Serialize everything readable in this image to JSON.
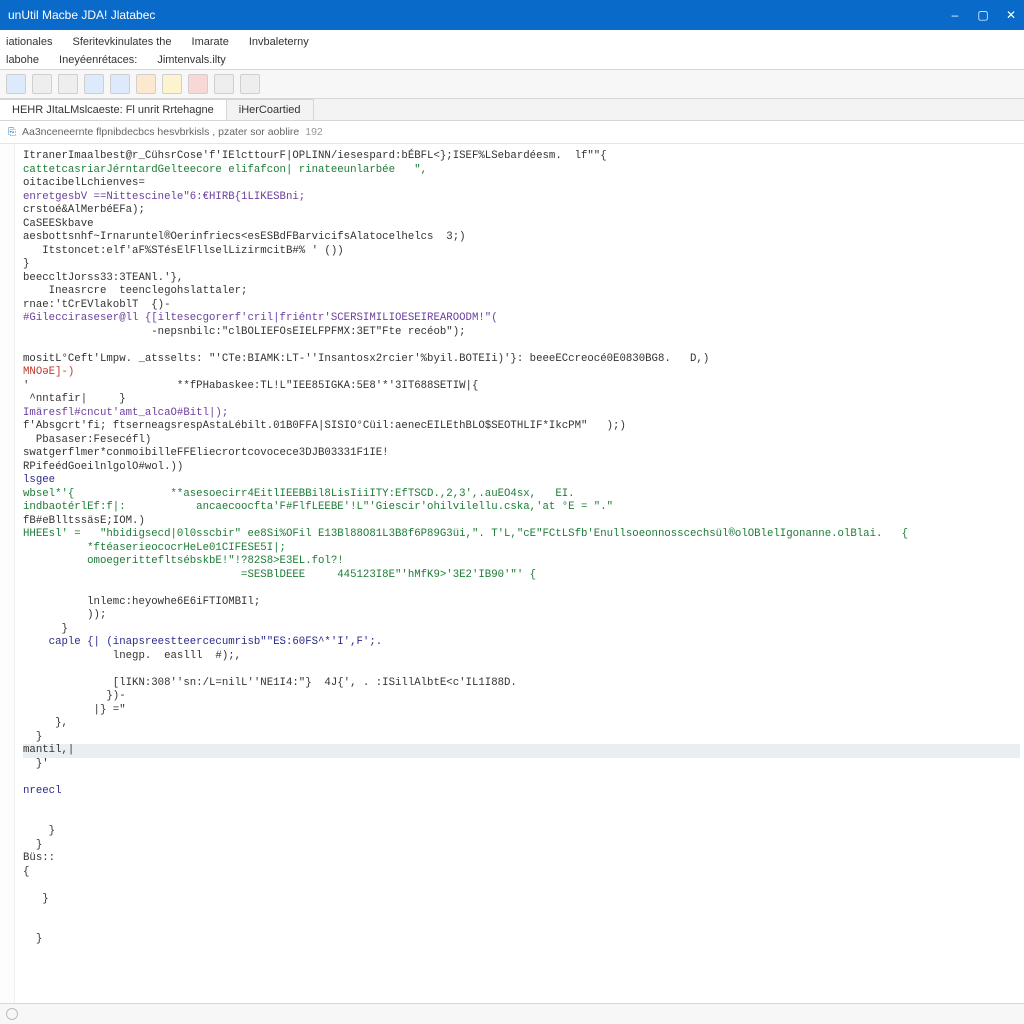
{
  "window": {
    "title": "unUtil Macbe JDA! Jlatabec"
  },
  "menu": {
    "row1": [
      "iationales",
      "Sferitevkinulates the",
      "Imarate",
      "Invbaleterny"
    ],
    "row2": [
      "labohe",
      "Ineyéenrétaces:",
      "Jimtenvals.ilty"
    ]
  },
  "toolbar_icons": [
    "page-icon",
    "layers-icon",
    "box-icon",
    "grid-icon",
    "save-icon",
    "folder-icon",
    "bullet-icon",
    "stop-icon",
    "doc-icon",
    "undo-icon"
  ],
  "toolbar_colors": [
    "blue",
    "gray",
    "gray",
    "blue",
    "blue",
    "orange",
    "yellow",
    "red",
    "gray",
    "gray"
  ],
  "tabs": [
    {
      "label": "HEHR JItaLMslcaeste: Fl  unrit  Rrtehagne",
      "active": true
    },
    {
      "label": "iHerCoartied",
      "active": false
    }
  ],
  "subheader": {
    "leading": "⎘",
    "text": "Aa3nceneernte flpnibdecbcs hesvbrkisls , pzater sor aoblire",
    "num": "192"
  },
  "code_lines": [
    {
      "t": "ItranerImaalbest@r_CühsrCose'f'IElcttourF|OPLINN/iesespard:bÉBFL<};ISEF%LSebardéesm.  lf\"\"{",
      "cls": ""
    },
    {
      "t": "cattetcasriarJérntardGelteecore elifafcon| rinateeunlarbée   \",",
      "cls": "str"
    },
    {
      "t": "oitacibelLchienves=",
      "cls": ""
    },
    {
      "t": "enretgesbV ==Nittescinele\"6:€HIRB{1LIKESBni;",
      "cls": "id"
    },
    {
      "t": "crstoé&AlMerbéEFa);",
      "cls": ""
    },
    {
      "t": "CaSEESkbave",
      "cls": ""
    },
    {
      "t": "aesbottsnhf~Irnaruntel®Oerinfriecs<esESBdFBarvicifsAlatocelhelcs  3;)",
      "cls": ""
    },
    {
      "t": "   Itstoncet:elf'aF%STésElFllselLizirmcitB#% ' ())",
      "cls": ""
    },
    {
      "t": "}",
      "cls": ""
    },
    {
      "t": "beeccltJorss33:3TEANl.'},",
      "cls": ""
    },
    {
      "t": "    Ineasrcre  teenclegohslattaler;",
      "cls": ""
    },
    {
      "t": "rnae:'tCrEVlakoblT  {)-",
      "cls": ""
    },
    {
      "t": "#Gilecciraseser@ll {[iltesecgorerf'cril|friéntr'SCERSIMILIOESEIREAROODM!\"(",
      "cls": "id"
    },
    {
      "t": "                    -nepsnbilc:\"clBOLIEFOsEIELFPFMX:3ET\"Fte recéob\");",
      "cls": ""
    },
    {
      "t": "",
      "cls": ""
    },
    {
      "t": "mositL°Ceft'Lmpw. _atsselts: \"'CTe:BIAMK:LT-''Insantosx2rcier'%byil.BOTEIi)'}: beeeECcreocé0E0830BG8.   D,)",
      "cls": ""
    },
    {
      "t": "MNOǝE]-)",
      "cls": "err"
    },
    {
      "t": "'                       **fPHabaskee:TL!L\"IEE85IGKA:5E8'*'3IT688SETIW|{",
      "cls": ""
    },
    {
      "t": " ^nntafir|     }",
      "cls": ""
    },
    {
      "t": "Imäresfl#cncut'amt_alcaO#Bitl|);",
      "cls": "id"
    },
    {
      "t": "f'Absgcrt'fi; ftserneagsrespAstaLébilt.01B0FFA|SISIO°Cüil:aenecEILEthBLO$SEOTHLIF*IkcPM\"   );)",
      "cls": ""
    },
    {
      "t": "  Pbasaser:Fesecéfl)",
      "cls": ""
    },
    {
      "t": "swatgerflmer*conmoibilleFFEliecrortcovocece3DJB03331F1IE!",
      "cls": ""
    },
    {
      "t": "RPifeédGoeilnlgolO#wol.))",
      "cls": ""
    },
    {
      "t": "lsgee",
      "cls": "kw"
    },
    {
      "t": "wbsel*'{               **asesoecirr4EitlIEEBBil8LisIiiITY:EfTSCD.,2,3',.auEO4sx,   EI.",
      "cls": "str"
    },
    {
      "t": "indbaotérlEf:f|:           ancaecoocfta'F#FlfLEEBE'!L\"'Giescir'ohilvilellu.cska,'at °E = \".\"",
      "cls": "str"
    },
    {
      "t": "fB#eBlltssäsE;IOM.)",
      "cls": ""
    },
    {
      "t": "HHEEsl' =   \"hbidigsecd|0l0sscbir\" ee8Si%OFil E13Bl88O81L3B8f6P89G3üi,\". T'L,\"cE\"FCtLSfb'Enullsoeonnosscechsül®olOBlelIgonanne.olBlai.   {",
      "cls": "str"
    },
    {
      "t": "          *ftéaserieococrHeLe01CIFESE5I|;",
      "cls": "str"
    },
    {
      "t": "          omoegerittefltsébskbE!\"!?82S8>E3EL.fol?!",
      "cls": "str"
    },
    {
      "t": "                                  =SESBlDEEE     445123I8E\"'hMfK9>'3E2'IB90'\"' {",
      "cls": "str"
    },
    {
      "t": "",
      "cls": ""
    },
    {
      "t": "          lnlemc:heyowhe6E6iFTIOMBIl;",
      "cls": ""
    },
    {
      "t": "          ));",
      "cls": ""
    },
    {
      "t": "      }",
      "cls": ""
    },
    {
      "t": "    caple {| (inapsreestteercecumrisb\"\"ES:60FS^*'I',F';.",
      "cls": "kw"
    },
    {
      "t": "              lnegp.  easlll  #);,",
      "cls": ""
    },
    {
      "t": "",
      "cls": ""
    },
    {
      "t": "              [lIKN:308''sn:/L=nilL''NE1I4:\"}  4J{', . :ISillAlbtE<c'IL1I88D.",
      "cls": ""
    },
    {
      "t": "             })-",
      "cls": ""
    },
    {
      "t": "           |} =\"",
      "cls": ""
    },
    {
      "t": "     },",
      "cls": ""
    },
    {
      "t": "  }",
      "cls": ""
    },
    {
      "t": "mantil,|",
      "cls": "hl"
    },
    {
      "t": "  }'",
      "cls": ""
    },
    {
      "t": "",
      "cls": ""
    },
    {
      "t": "nreecl",
      "cls": "kw"
    },
    {
      "t": "",
      "cls": ""
    },
    {
      "t": "",
      "cls": ""
    },
    {
      "t": "    }",
      "cls": ""
    },
    {
      "t": "  }",
      "cls": ""
    },
    {
      "t": "Büs::",
      "cls": ""
    },
    {
      "t": "{",
      "cls": ""
    },
    {
      "t": "",
      "cls": ""
    },
    {
      "t": "   }",
      "cls": ""
    },
    {
      "t": "",
      "cls": ""
    },
    {
      "t": "",
      "cls": ""
    },
    {
      "t": "  }",
      "cls": ""
    }
  ],
  "statusbar": {
    "text": ""
  }
}
